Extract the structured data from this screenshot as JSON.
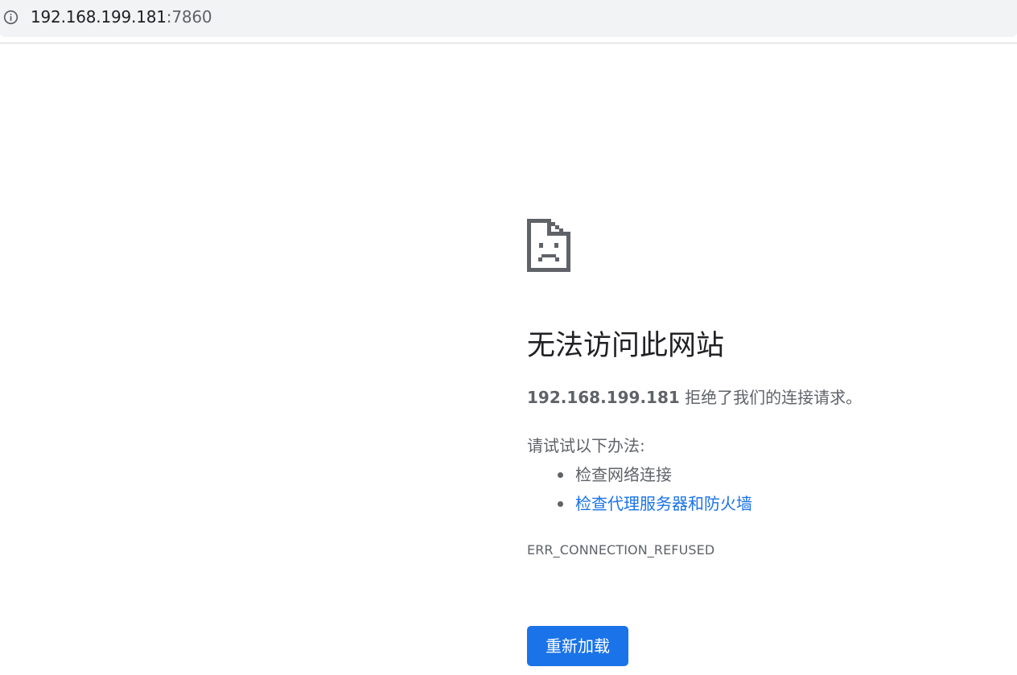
{
  "browser": {
    "url_host": "192.168.199.181",
    "url_port": ":7860",
    "info_icon": "info-circle-icon"
  },
  "error_page": {
    "icon": "sad-page-icon",
    "headline": "无法访问此网站",
    "detail_host": "192.168.199.181",
    "detail_message": " 拒绝了我们的连接请求。",
    "suggestions_intro": "请试试以下办法:",
    "suggestions": [
      {
        "label": "检查网络连接",
        "is_link": false
      },
      {
        "label": "检查代理服务器和防火墙",
        "is_link": true
      }
    ],
    "error_code": "ERR_CONNECTION_REFUSED",
    "reload_label": "重新加载"
  },
  "colors": {
    "link": "#1a73e8",
    "button_bg": "#1a73e8",
    "text_secondary": "#5f6368",
    "text_primary": "#202124",
    "address_bar_bg": "#f1f3f4"
  }
}
